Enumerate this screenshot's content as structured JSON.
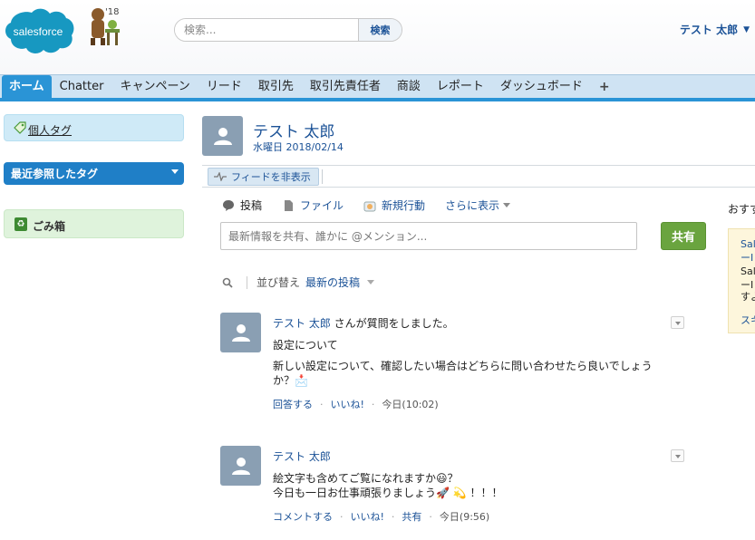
{
  "header": {
    "logo_text": "salesforce",
    "mascot_year": "'18",
    "search_placeholder": "検索...",
    "search_button": "検索",
    "user_name": "テスト 太郎"
  },
  "tabs": [
    {
      "label": "ホーム",
      "active": true
    },
    {
      "label": "Chatter"
    },
    {
      "label": "キャンペーン"
    },
    {
      "label": "リード"
    },
    {
      "label": "取引先"
    },
    {
      "label": "取引先責任者"
    },
    {
      "label": "商談"
    },
    {
      "label": "レポート"
    },
    {
      "label": "ダッシュボード"
    },
    {
      "label": "+"
    }
  ],
  "sidebar": {
    "personal_tags": "個人タグ",
    "recent_tags": "最近参照したタグ",
    "trash": "ごみ箱"
  },
  "profile": {
    "name": "テスト 太郎",
    "date": "水曜日 2018/02/14",
    "feed_toggle": "フィードを非表示"
  },
  "publisher": {
    "tabs": [
      "投稿",
      "ファイル",
      "新規行動",
      "さらに表示"
    ],
    "input_placeholder": "最新情報を共有、誰かに @メンション...",
    "share_button": "共有"
  },
  "sort": {
    "label": "並び替え",
    "value": "最新の投稿"
  },
  "feed": [
    {
      "author": "テスト 太郎",
      "head_suffix": " さんが質問をしました。",
      "title": "設定について",
      "body": "新しい設定について、確認したい場合はどちらに問い合わせたら良いでしょうか？📩",
      "actions": [
        "回答する",
        "いいね!"
      ],
      "time": "今日(10:02)"
    },
    {
      "author": "テスト 太郎",
      "line1": "絵文字も含めてご覧になれますか😃？",
      "line2": "今日も一日お仕事頑張りましょう🚀 💫 ！！！",
      "actions": [
        "コメントする",
        "いいね!",
        "共有"
      ],
      "time": "今日(9:56)"
    }
  ],
  "right_panel": {
    "title": "おすすめ",
    "lines": [
      "Sal",
      "ーI",
      "Sal",
      "ーI",
      "すよ",
      "スキ"
    ]
  },
  "colors": {
    "brand_blue": "#2a94d6",
    "link_blue": "#1b5297",
    "share_green": "#6aa43f"
  }
}
